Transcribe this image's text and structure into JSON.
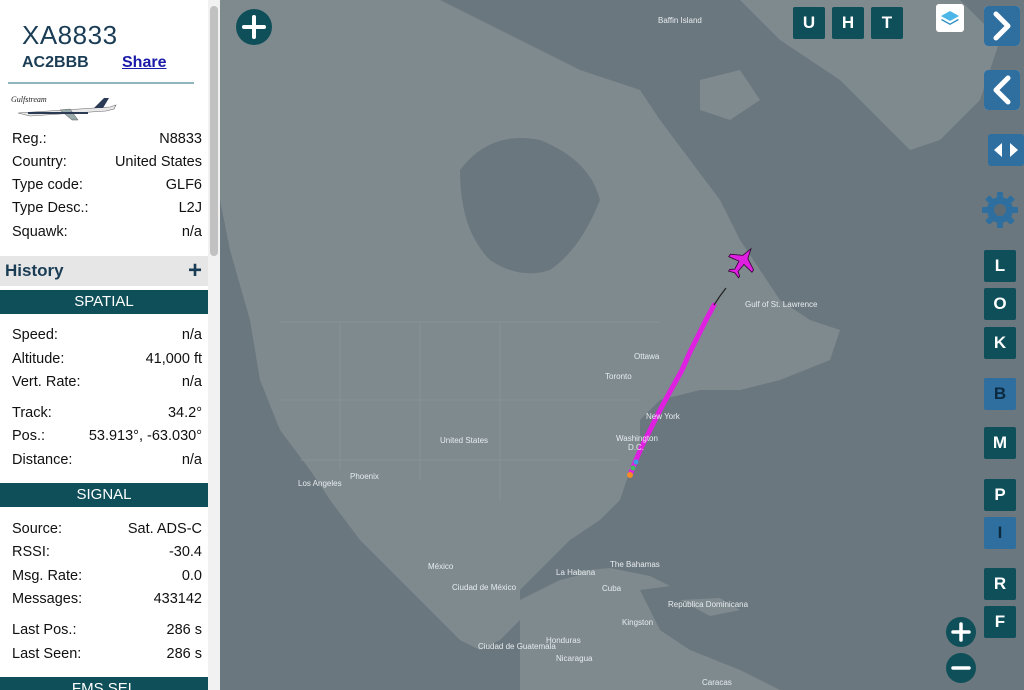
{
  "aircraft": {
    "callsign": "XA8833",
    "hex": "AC2BBB",
    "share_label": "Share",
    "logo_text": "Gulfstream"
  },
  "details": [
    {
      "label": "Reg.:",
      "value": "N8833"
    },
    {
      "label": "Country:",
      "value": "United States"
    },
    {
      "label": "Type code:",
      "value": "GLF6"
    },
    {
      "label": "Type Desc.:",
      "value": "L2J"
    },
    {
      "label": "Squawk:",
      "value": "n/a"
    }
  ],
  "history": {
    "title": "History",
    "add_icon": "plus-icon"
  },
  "spatial": {
    "title": "SPATIAL",
    "rows": [
      {
        "label": "Speed:",
        "value": "n/a"
      },
      {
        "label": "Altitude:",
        "value": "41,000 ft"
      },
      {
        "label": "Vert. Rate:",
        "value": "n/a"
      },
      {
        "label": "Track:",
        "value": "34.2°"
      },
      {
        "label": "Pos.:",
        "value": "53.913°, -63.030°"
      },
      {
        "label": "Distance:",
        "value": "n/a"
      }
    ]
  },
  "signal": {
    "title": "SIGNAL",
    "rows": [
      {
        "label": "Source:",
        "value": "Sat. ADS-C"
      },
      {
        "label": "RSSI:",
        "value": "-30.4"
      },
      {
        "label": "Msg. Rate:",
        "value": "0.0"
      },
      {
        "label": "Messages:",
        "value": "433142"
      },
      {
        "label": "Last Pos.:",
        "value": "286 s"
      },
      {
        "label": "Last Seen:",
        "value": "286 s"
      }
    ]
  },
  "fms_title": "FMS SEL",
  "map": {
    "top_buttons": [
      "U",
      "H",
      "T"
    ],
    "side_buttons": [
      "L",
      "O",
      "K",
      "B",
      "M",
      "P",
      "I",
      "R",
      "F"
    ],
    "labels": {
      "baffin": "Baffin Island",
      "gulf": "Gulf of St. Lawrence",
      "ottawa": "Ottawa",
      "toronto": "Toronto",
      "newyork": "New York",
      "washington": "Washington",
      "dc": "D.C.",
      "us": "United States",
      "phoenix": "Phoenix",
      "la": "Los Angeles",
      "mexico": "México",
      "ciudad_mx": "Ciudad de México",
      "habana": "La Habana",
      "cuba": "Cuba",
      "bahamas": "The Bahamas",
      "republica": "República Dominicana",
      "kingston": "Kingston",
      "guatemala": "Ciudad de Guatemala",
      "honduras": "Honduras",
      "nicaragua": "Nicaragua",
      "caracas": "Caracas"
    },
    "route_color": "#e020e0",
    "accent": "#0f4f59"
  }
}
